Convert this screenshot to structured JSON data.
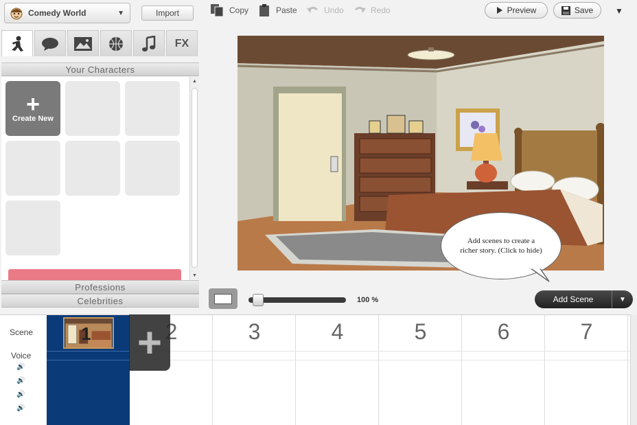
{
  "toolbar": {
    "theme": "Comedy World",
    "import_label": "Import",
    "copy_label": "Copy",
    "paste_label": "Paste",
    "undo_label": "Undo",
    "redo_label": "Redo",
    "preview_label": "Preview",
    "save_label": "Save"
  },
  "library": {
    "tabs": [
      "characters",
      "props",
      "backgrounds",
      "effects",
      "music",
      "FX"
    ],
    "active_tab": "characters",
    "section_title": "Your Characters",
    "create_new_label": "Create New",
    "categories": [
      "Professions",
      "Celebrities"
    ]
  },
  "stage": {
    "bubble_text": "Add scenes to create a richer story. (Click to hide)"
  },
  "zoom": {
    "level": "100 %",
    "fraction": 0.1
  },
  "add_scene_label": "Add Scene",
  "timeline": {
    "scene_label": "Scene",
    "voice_label": "Voice",
    "scene_numbers": [
      "2",
      "3",
      "4",
      "5",
      "6",
      "7"
    ],
    "first_scene_number": "1"
  },
  "colors": {
    "selected_scene": "#0a3a78",
    "accent_pink": "#ea7a86",
    "add_scene_bg": "#2e2e2e"
  }
}
